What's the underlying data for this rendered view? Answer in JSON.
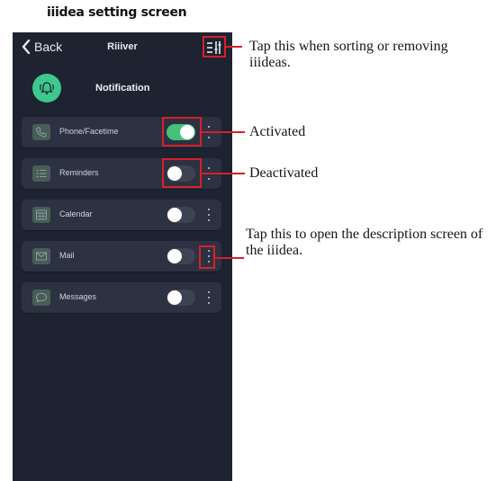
{
  "heading": "iiidea setting screen",
  "navbar": {
    "back_label": "Back",
    "title": "Riiiver"
  },
  "app": {
    "title": "Notification"
  },
  "items": [
    {
      "label": "Phone/Facetime",
      "icon": "phone-icon",
      "enabled": true
    },
    {
      "label": "Reminders",
      "icon": "list-icon",
      "enabled": false
    },
    {
      "label": "Calendar",
      "icon": "calendar-icon",
      "enabled": false
    },
    {
      "label": "Mail",
      "icon": "mail-icon",
      "enabled": false
    },
    {
      "label": "Messages",
      "icon": "chat-bubble-icon",
      "enabled": false
    }
  ],
  "callouts": {
    "sort": "Tap this when sorting or removing iiideas.",
    "activated": "Activated",
    "deactivated": "Deactivated",
    "description": "Tap this to open the description screen of the iiidea."
  },
  "colors": {
    "background": "#1d2330",
    "card": "#2c3241",
    "toggle_on": "#46c07a",
    "accent": "#3fc88c",
    "highlight": "#d91e2c"
  }
}
